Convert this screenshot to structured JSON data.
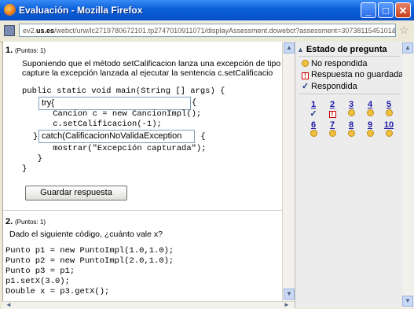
{
  "window": {
    "title": "Evaluación - Mozilla Firefox",
    "minimize": "_",
    "maximize": "□",
    "close": "✕"
  },
  "address": {
    "prefix": "ev2.",
    "domain": "us.es",
    "path": "/webct/urw/lc2719780672101.tp2747010911071/displayAssessment.dowebct?assessment=3073811545101&fwdPage=d"
  },
  "questions": [
    {
      "number": "1.",
      "points": "(Puntos: 1)",
      "text_line1": "Suponiendo que el método setCalificacion lanza una excepción de tipo",
      "text_line2": "capture la excepción lanzada al ejecutar la sentencia c.setCalificacio",
      "code_lines": [
        "public static void main(String [] args) {",
        "{",
        "    Cancion c = new CancionImpl();",
        "    c.setCalificacion(-1);",
        "}",
        " {",
        "    mostrar(\"Excepción capturada\");",
        "  }",
        "}"
      ],
      "blank1": "try{",
      "blank2": "catch(CalificacionNoValidaException",
      "save_button": "Guardar respuesta"
    },
    {
      "number": "2.",
      "points": "(Puntos: 1)",
      "text": "Dado el siguiente código, ¿cuánto vale x?",
      "code_lines": [
        "Punto p1 = new PuntoImpl(1.0,1.0);",
        "Punto p2 = new PuntoImpl(2.0,1.0);",
        "Punto p3 = p1;",
        "p1.setX(3.0);",
        "Double x = p3.getX();"
      ]
    }
  ],
  "sidebar": {
    "title": "Estado de pregunta",
    "legend": [
      {
        "icon": "dot",
        "label": "No respondida"
      },
      {
        "icon": "flag",
        "label": "Respuesta no guardada"
      },
      {
        "icon": "check",
        "label": "Respondida"
      }
    ],
    "questions": [
      {
        "num": "1",
        "status": "answered"
      },
      {
        "num": "2",
        "status": "unsaved"
      },
      {
        "num": "3",
        "status": "unanswered"
      },
      {
        "num": "4",
        "status": "unanswered"
      },
      {
        "num": "5",
        "status": "unanswered"
      },
      {
        "num": "6",
        "status": "unanswered"
      },
      {
        "num": "7",
        "status": "unanswered"
      },
      {
        "num": "8",
        "status": "unanswered"
      },
      {
        "num": "9",
        "status": "unanswered"
      },
      {
        "num": "10",
        "status": "unanswered"
      }
    ]
  },
  "glyphs": {
    "check": "✓",
    "flag": "!",
    "up": "▲",
    "down": "▼",
    "left": "◄",
    "right": "►",
    "star": "☆"
  }
}
